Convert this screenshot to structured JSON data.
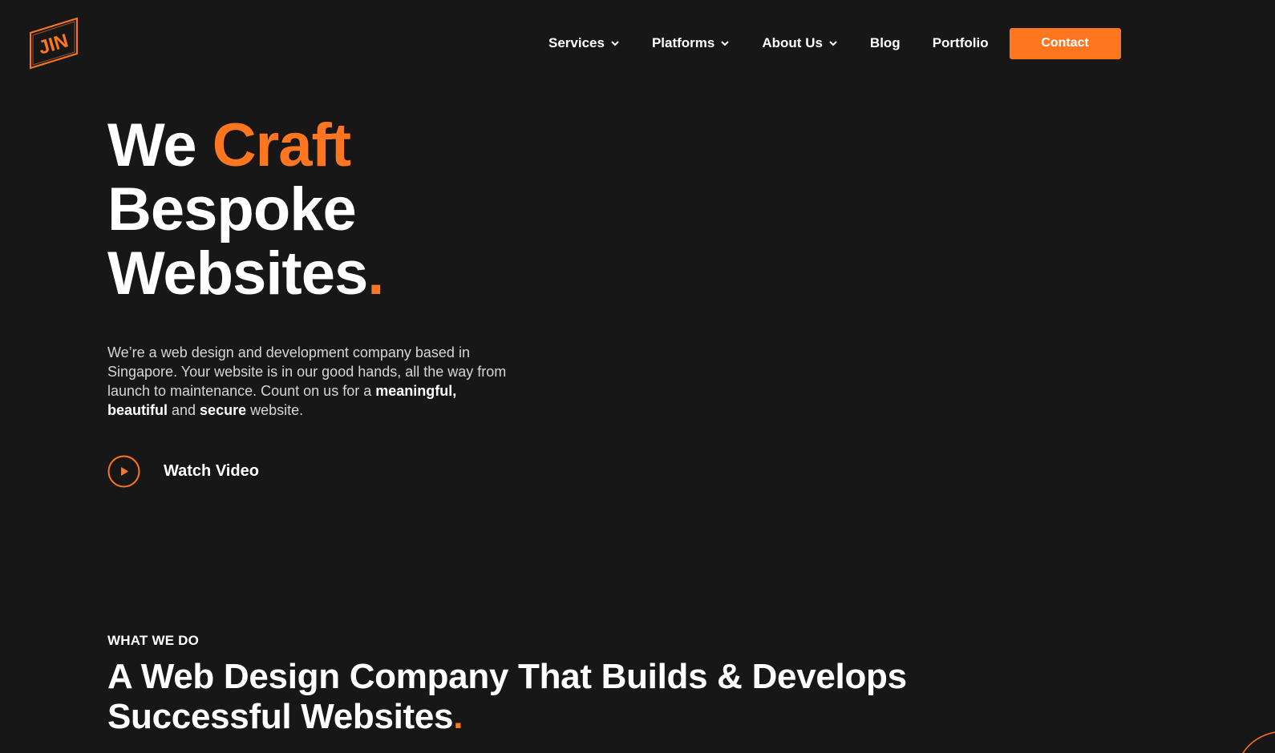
{
  "brand": {
    "logo_text": "JIN",
    "accent_color": "#ff7621",
    "background": "#171717"
  },
  "nav": {
    "items": [
      {
        "label": "Services",
        "has_dropdown": true
      },
      {
        "label": "Platforms",
        "has_dropdown": true
      },
      {
        "label": "About Us",
        "has_dropdown": true
      },
      {
        "label": "Blog",
        "has_dropdown": false
      },
      {
        "label": "Portfolio",
        "has_dropdown": false
      }
    ],
    "contact_label": "Contact"
  },
  "hero": {
    "title_we": "We ",
    "title_craft": "Craft",
    "title_line2": "Bespoke",
    "title_line3": "Websites",
    "title_period": ".",
    "desc_text": "We’re a web design and development company based in Singapore. Your website is in our good hands, all the way from launch to maintenance. Count on us for a ",
    "desc_bold1": "meaningful,",
    "desc_bold2": "beautiful",
    "desc_and": " and ",
    "desc_bold3": "secure",
    "desc_end": " website.",
    "watch_label": "Watch Video"
  },
  "section": {
    "eyebrow": "WHAT WE DO",
    "title_line1": "A Web Design Company That Builds & Develops",
    "title_line2": "Successful Websites",
    "title_period": "."
  }
}
